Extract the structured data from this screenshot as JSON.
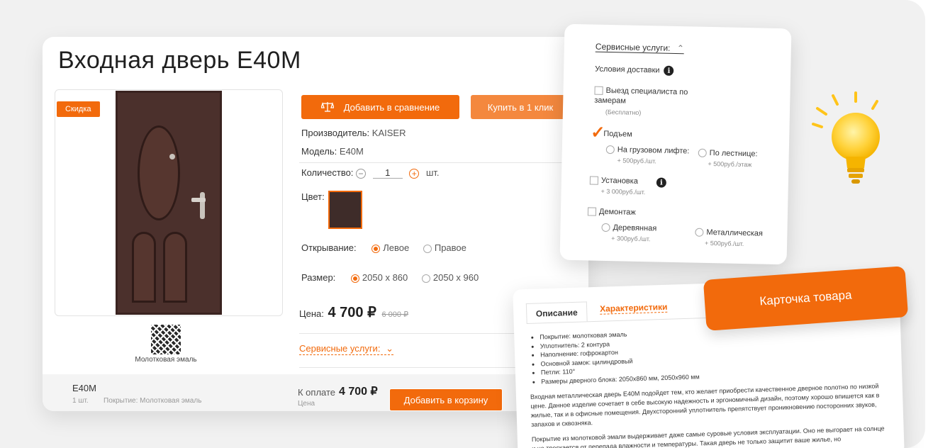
{
  "product": {
    "title": "Входная дверь Е40М",
    "sale_badge": "Скидка",
    "material_caption": "Молотковая эмаль",
    "compare_button": "Добавить в сравнение",
    "one_click_button": "Купить в 1 клик",
    "manufacturer_label": "Производитель:",
    "manufacturer_value": "KAISER",
    "model_label": "Модель:",
    "model_value": "Е40М",
    "quantity_label": "Количество:",
    "quantity_minus": "−",
    "quantity_value": "1",
    "quantity_plus": "+",
    "quantity_unit": "шт.",
    "color_label": "Цвет:",
    "opening_label": "Открывание:",
    "opening_options": [
      "Левое",
      "Правое"
    ],
    "opening_selected": "Левое",
    "size_label": "Размер:",
    "size_options": [
      "2050 х 860",
      "2050 х 960"
    ],
    "size_selected": "2050 х 860",
    "price_label": "Цена:",
    "price": "4 700 ₽",
    "old_price": "6 000 ₽",
    "services_toggle": "Сервисные услуги:"
  },
  "footer": {
    "name": "Е40М",
    "qty": "1 шт.",
    "coating": "Покрытие: Молотковая эмаль",
    "pay_label": "К оплате",
    "pay_value": "4 700 ₽",
    "pay_sub": "Цена",
    "cart_button": "Добавить в корзину"
  },
  "services": {
    "title": "Сервисные услуги:",
    "delivery": "Условия доставки",
    "measure": "Выезд специалиста по замерам",
    "measure_note": "(Бесплатно)",
    "lift": "Подъем",
    "lift_cargo": "На грузовом лифте:",
    "lift_cargo_price": "+ 500руб./шт.",
    "lift_stairs": "По лестнице:",
    "lift_stairs_price": "+ 500руб./этаж",
    "install": "Установка",
    "install_price": "+ 3 000руб./шт.",
    "dismantle": "Демонтаж",
    "wooden": "Деревянная",
    "wooden_price": "+ 300руб./шт.",
    "metal": "Металлическая",
    "metal_price": "+ 500руб./шт."
  },
  "description": {
    "tab_description": "Описание",
    "tab_specs": "Характеристики",
    "specs": [
      "Покрытие: молотковая эмаль",
      "Уплотнитель: 2 контура",
      "Наполнение: гофрокартон",
      "Основной замок: цилиндровый",
      "Петли: 110°",
      "Размеры дверного блока: 2050х860 мм, 2050х960 мм"
    ],
    "paragraph1": "Входная металлическая дверь Е40М подойдет тем, кто желает приобрести качественное дверное полотно по низкой цене. Данное изделие сочетает в себе высокую надежность и эргономичный дизайн, поэтому хорошо впишется как в жилые, так и в офисные помещения. Двухсторонний уплотнитель препятствует проникновению посторонних звуков, запахов и сквозняка.",
    "paragraph2": "Покрытие из молотковой эмали выдерживает даже самые суровые условия эксплуатации. Оно не выгорает на солнце и не трескается от перепада влажности и температуры. Такая дверь не только защитит ваше жилье, но"
  },
  "label": "Карточка товара",
  "colors": {
    "accent": "#f26a0c",
    "door": "#4b302c"
  }
}
